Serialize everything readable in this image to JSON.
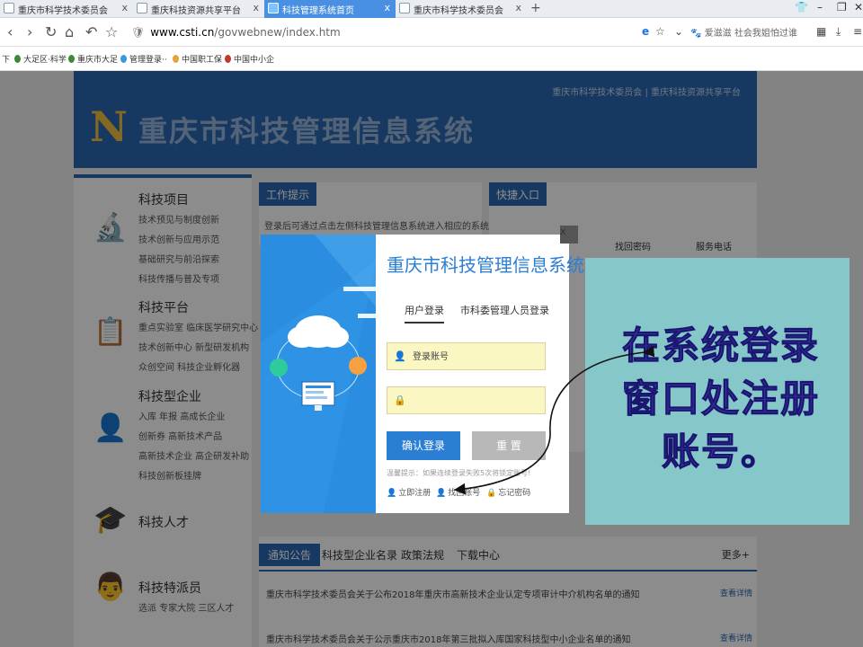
{
  "browser": {
    "tabs": [
      {
        "label": "重庆市科学技术委员会"
      },
      {
        "label": "重庆科技资源共享平台"
      },
      {
        "label": "科技管理系统首页"
      },
      {
        "label": "重庆市科学技术委员会"
      }
    ],
    "new_tab": "+",
    "close_glyph": "x",
    "url_domain": "www.csti.cn",
    "url_path": "/govwebnew/index.htm",
    "search_text": "爱滋滋 社会我姐怕过谁",
    "bookmarks": [
      "下",
      "大足区·科学",
      "重庆市大足",
      "管理登录··",
      "中国职工保",
      "中国中小企"
    ]
  },
  "page": {
    "banner_links": "重庆市科学技术委员会   |   重庆科技资源共享平台",
    "logo": "N",
    "system_name": "重庆市科技管理信息系统",
    "left_nav": [
      {
        "title": "科技项目",
        "items": [
          "技术预见与制度创新",
          "技术创新与应用示范",
          "基础研究与前沿探索",
          "科技传播与普及专项"
        ]
      },
      {
        "title": "科技平台",
        "items": [
          "重点实验室  临床医学研究中心",
          "技术创新中心  新型研发机构",
          "众创空间  科技企业孵化器"
        ]
      },
      {
        "title": "科技型企业",
        "items": [
          "入库  年报  高成长企业",
          "创新券  高新技术产品",
          "高新技术企业  高企研发补助",
          "科技创新板挂牌"
        ]
      },
      {
        "title": "科技人才",
        "items": []
      },
      {
        "title": "科技特派员",
        "items": [
          "选派  专家大院  三区人才"
        ]
      }
    ],
    "work_title": "工作提示",
    "work_text": "登录后可通过点击左侧科技管理信息系统进入相应的系统",
    "quick_title": "快捷入口",
    "quick_items": [
      "找回密码",
      "服务电话"
    ],
    "notice_tabs": [
      "通知公告",
      "科技型企业名录",
      "政策法规",
      "下载中心"
    ],
    "notice_more": "更多+",
    "notices": [
      {
        "text": "重庆市科学技术委员会关于公布2018年重庆市高新技术企业认定专项审计中介机构名单的通知",
        "link": "查看详情"
      },
      {
        "text": "重庆市科学技术委员会关于公示重庆市2018年第三批拟入库国家科技型中小企业名单的通知",
        "link": "查看详情"
      }
    ]
  },
  "modal": {
    "title": "重庆市科技管理信息系统",
    "tabs": [
      "用户登录",
      "市科委管理人员登录"
    ],
    "account_placeholder": "登录账号",
    "password_value": "",
    "login_button": "确认登录",
    "reset_button": "重  置",
    "hint": "温馨提示：如果连续登录失败5次将锁定账号!",
    "links": [
      "立即注册",
      "找回账号",
      "忘记密码"
    ],
    "close": "x"
  },
  "annotation": {
    "text": "在系统登录窗口处注册账号。",
    "bg_color": "#86c7c9",
    "text_color": "#3c36a8"
  }
}
